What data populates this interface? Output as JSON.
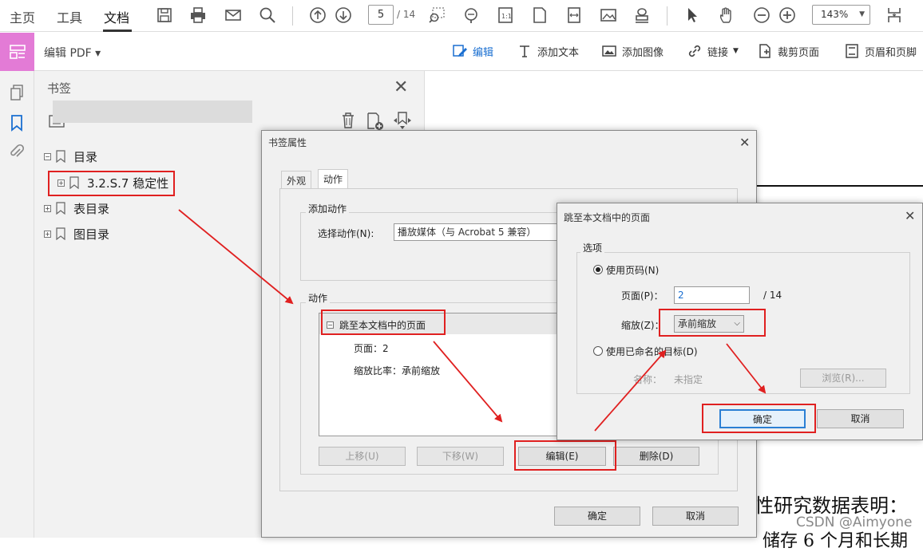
{
  "menubar": {
    "tabs": [
      "主页",
      "工具",
      "文档"
    ],
    "page_current": "5",
    "page_total": "/ 14",
    "zoom": "143%"
  },
  "toolbar2": {
    "edit_pdf": "编辑 PDF",
    "edit": "编辑",
    "add_text": "添加文本",
    "add_image": "添加图像",
    "link": "链接",
    "crop": "裁剪页面",
    "header_footer": "页眉和页脚"
  },
  "bookmarks": {
    "title": "书签",
    "items": [
      {
        "label": "目录"
      },
      {
        "label": "3.2.S.7 稳定性"
      },
      {
        "label": "表目录"
      },
      {
        "label": "图目录"
      }
    ]
  },
  "dialog_props": {
    "title": "书签属性",
    "tabs": [
      "外观",
      "动作"
    ],
    "add_action_group": "添加动作",
    "select_action_label": "选择动作(N):",
    "select_action_value": "播放媒体（与 Acrobat 5 兼容）",
    "actions_group": "动作",
    "action_name": "跳至本文档中的页面",
    "action_page": "页面：2",
    "action_zoom": "缩放比率：承前缩放",
    "btn_up": "上移(U)",
    "btn_down": "下移(W)",
    "btn_edit": "编辑(E)",
    "btn_delete": "删除(D)",
    "btn_ok": "确定",
    "btn_cancel": "取消"
  },
  "dialog_goto": {
    "title": "跳至本文档中的页面",
    "options_group": "选项",
    "use_page_number": "使用页码(N)",
    "page_label": "页面(P)：",
    "page_value": "2",
    "page_total": "/ 14",
    "zoom_label": "缩放(Z)：",
    "zoom_value": "承前缩放",
    "use_named_dest": "使用已命名的目标(D)",
    "name_label": "名称：",
    "name_value": "未指定",
    "browse": "浏览(R)...",
    "ok": "确定",
    "cancel": "取消"
  },
  "document": {
    "text1": "性研究数据表明：",
    "text2": "储存 6 个月和长期"
  },
  "watermark": "CSDN @Aimyone",
  "colors": {
    "accent_blue": "#1a6fd1",
    "edit_pdf_badge": "#e37bd6",
    "annotation_red": "#e02020"
  }
}
